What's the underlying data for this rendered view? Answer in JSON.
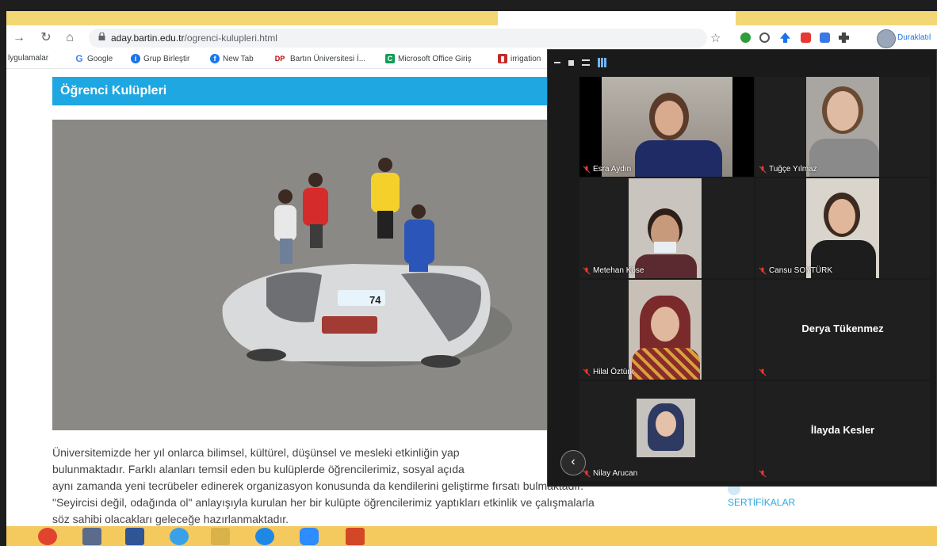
{
  "browser": {
    "url_host": "aday.bartin.edu.tr",
    "url_path": "/ogrenci-kulupleri.html",
    "profile_label": "Duraklatıl"
  },
  "bookmarks": [
    {
      "label": "lygulamalar",
      "icon": "apps-icon",
      "color": "#ffffff"
    },
    {
      "label": "Google",
      "icon": "google-icon",
      "color": "#4285f4"
    },
    {
      "label": "Grup Birleştir",
      "icon": "circle-icon",
      "color": "#1a73e8"
    },
    {
      "label": "New Tab",
      "icon": "facebook-icon",
      "color": "#1877f2"
    },
    {
      "label": "Bartın Üniversitesi İ...",
      "icon": "dp-icon",
      "color": "#c00000"
    },
    {
      "label": "Microsoft Office Giriş",
      "icon": "office-icon",
      "color": "#0f9d58"
    },
    {
      "label": "irrigation",
      "icon": "book-icon",
      "color": "#c62828"
    }
  ],
  "page": {
    "section_title": "Öğrenci Kulüpleri",
    "paragraph_lines": [
      "Üniversitemizde her yıl onlarca bilimsel, kültürel, düşünsel ve mesleki etkinliğin yap",
      "bulunmaktadır. Farklı alanları temsil eden bu kulüplerde öğrencilerimiz, sosyal açıda",
      "aynı zamanda yeni tecrübeler edinerek organizasyon konusunda da kendilerini geliştirme fırsatı bulmaktadır.",
      "\"Seyircisi değil, odağında ol\" anlayışıyla kurulan her bir kulüpte öğrencilerimiz yaptıkları etkinlik ve çalışmalarla",
      "söz sahibi olacakları geleceğe hazırlanmaktadır."
    ],
    "car_number": "74",
    "sidebar_cert": "SERTİFİKALAR"
  },
  "meeting": {
    "participants": [
      {
        "name": "Esra Aydın",
        "video": true
      },
      {
        "name": "Tuğçe Yılmaz",
        "video": true
      },
      {
        "name": "Metehan Köse",
        "video": true
      },
      {
        "name": "Cansu SOYTÜRK",
        "video": true
      },
      {
        "name": "Hilal Öztürk",
        "video": true
      },
      {
        "name": "Derya Tükenmez",
        "video": false
      },
      {
        "name": "Nilay Arucan",
        "video": true
      },
      {
        "name": "İlayda Kesler",
        "video": false
      }
    ]
  },
  "colors": {
    "accent": "#1ea7e1",
    "taskbar": "#f4c95d",
    "mic_muted": "#e53935"
  }
}
